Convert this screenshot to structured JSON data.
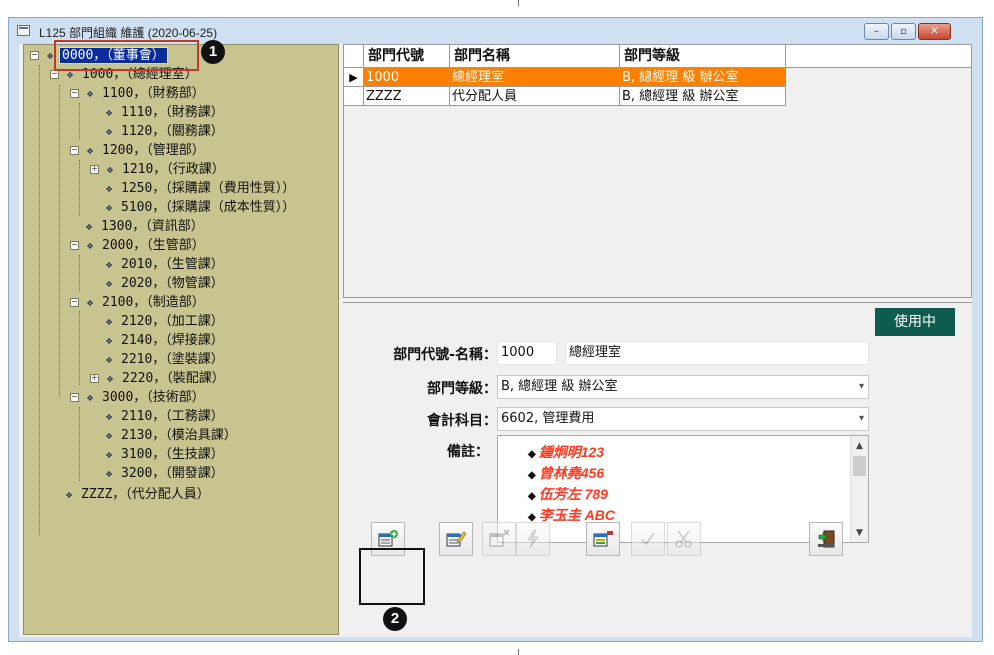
{
  "window": {
    "title": "L125 部門組織 維護 (2020-06-25)",
    "controls": {
      "minimize": "–",
      "maximize": "▫",
      "close": "✕"
    }
  },
  "tree": {
    "nodes": [
      {
        "label": "0000，（董事會）",
        "selected": true
      },
      {
        "label": "1000，（總經理室）"
      },
      {
        "label": "1100，（財務部）"
      },
      {
        "label": "1110，（財務課）"
      },
      {
        "label": "1120，（關務課）"
      },
      {
        "label": "1200，（管理部）"
      },
      {
        "label": "1210，（行政課）"
      },
      {
        "label": "1250，（採購課（費用性質））"
      },
      {
        "label": "5100，（採購課（成本性質））"
      },
      {
        "label": "1300，（資訊部）"
      },
      {
        "label": "2000，（生管部）"
      },
      {
        "label": "2010，（生管課）"
      },
      {
        "label": "2020，（物管課）"
      },
      {
        "label": "2100，（制造部）"
      },
      {
        "label": "2120，（加工課）"
      },
      {
        "label": "2140，（焊接課）"
      },
      {
        "label": "2210，（塗裝課）"
      },
      {
        "label": "2220，（裝配課）"
      },
      {
        "label": "3000，（技術部）"
      },
      {
        "label": "2110，（工務課）"
      },
      {
        "label": "2130，（模治具課）"
      },
      {
        "label": "3100，（生技課）"
      },
      {
        "label": "3200，（開發課）"
      },
      {
        "label": "ZZZZ，（代分配人員）"
      }
    ],
    "expander_open": "−",
    "expander_closed": "+"
  },
  "grid": {
    "columns": [
      "部門代號",
      "部門名稱",
      "部門等級"
    ],
    "rows": [
      {
        "code": "1000",
        "name": "總經理室",
        "level": "B, 總經理 級 辦公室",
        "active": true
      },
      {
        "code": "ZZZZ",
        "name": "代分配人員",
        "level": "B, 總經理 級 辦公室"
      }
    ],
    "row_indicator": "▶"
  },
  "detail": {
    "status": "使用中",
    "code_name_label": "部門代號-名稱：",
    "code_value": "1000",
    "name_value": "總經理室",
    "level_label": "部門等級：",
    "level_value": "B, 總經理 級 辦公室",
    "account_label": "會計科目：",
    "account_value": "6602, 管理費用",
    "notes_label": "備註：",
    "notes": [
      "鍾炯明123",
      "曾林堯456",
      "伍芳左 789",
      "李玉圭 ABC"
    ],
    "bullet": "◆"
  },
  "toolbar": {
    "buttons": [
      {
        "name": "add",
        "icon": "add-record-icon",
        "enabled": true
      },
      {
        "name": "edit",
        "icon": "edit-record-icon",
        "enabled": true
      },
      {
        "name": "delete",
        "icon": "delete-record-icon",
        "enabled": false
      },
      {
        "name": "flash",
        "icon": "lightning-icon",
        "enabled": false
      },
      {
        "name": "query",
        "icon": "query-record-icon",
        "enabled": true
      },
      {
        "name": "confirm",
        "icon": "check-icon",
        "enabled": false
      },
      {
        "name": "cancel",
        "icon": "scissors-icon",
        "enabled": false
      },
      {
        "name": "exit",
        "icon": "exit-door-icon",
        "enabled": true
      }
    ]
  },
  "annotations": [
    "1",
    "2"
  ],
  "colors": {
    "selected_row": "#ff8000",
    "tree_bg": "#c8c490",
    "status_badge": "#0e5c4d",
    "note_text": "#ff3b1f",
    "annotation_box": "#c0392b"
  }
}
